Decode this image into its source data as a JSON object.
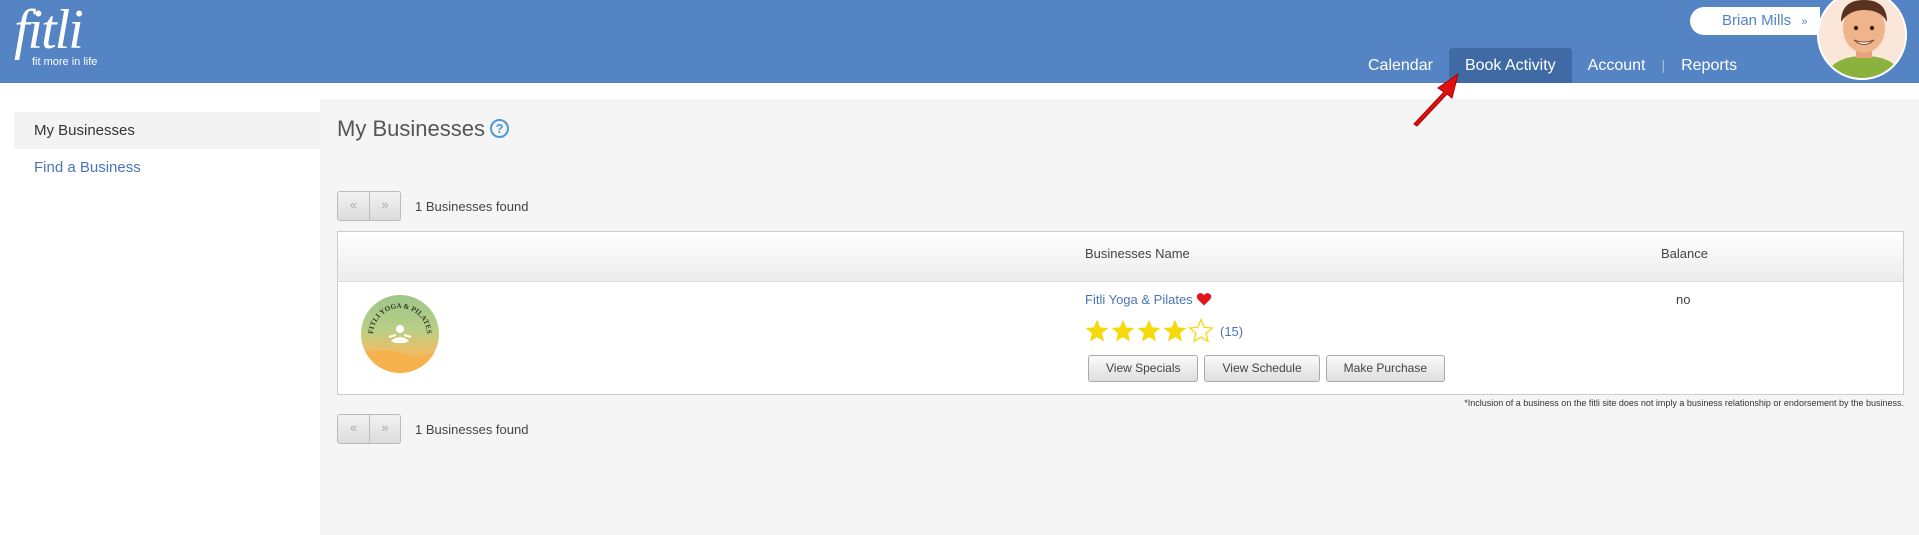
{
  "header": {
    "logo_text": "fitli",
    "logo_tagline": "fit more in life",
    "user_name": "Brian Mills",
    "nav": [
      {
        "label": "Calendar"
      },
      {
        "label": "Book Activity"
      },
      {
        "label": "Account"
      },
      {
        "label": "Reports"
      }
    ]
  },
  "sidebar": {
    "items": [
      {
        "label": "My Businesses"
      },
      {
        "label": "Find a Business"
      }
    ]
  },
  "main": {
    "title": "My Businesses",
    "help_glyph": "?",
    "pager": {
      "prev": "«",
      "next": "»",
      "count_text": "1 Businesses found"
    },
    "table": {
      "columns": [
        "Businesses Name",
        "Balance"
      ],
      "rows": [
        {
          "name": "Fitli Yoga & Pilates",
          "logo_text": "FITLI YOGA & PILATES",
          "rating": 4,
          "rating_max": 5,
          "rating_count": "(15)",
          "balance": "no",
          "actions": [
            "View Specials",
            "View Schedule",
            "Make Purchase"
          ]
        }
      ]
    },
    "disclaimer": "*Inclusion of a business on the fitli site does not imply a business relationship or endorsement by the business."
  },
  "colors": {
    "header_bg": "#5584c4",
    "nav_active_bg": "#3f6aa3",
    "link": "#4a75b8",
    "star": "#f5d90a",
    "heart": "#e3141c",
    "annotation_arrow": "#e01010"
  },
  "icons": [
    "help-icon",
    "heart-icon",
    "star-icon",
    "chevron-down-icon",
    "annotation-arrow-icon"
  ]
}
